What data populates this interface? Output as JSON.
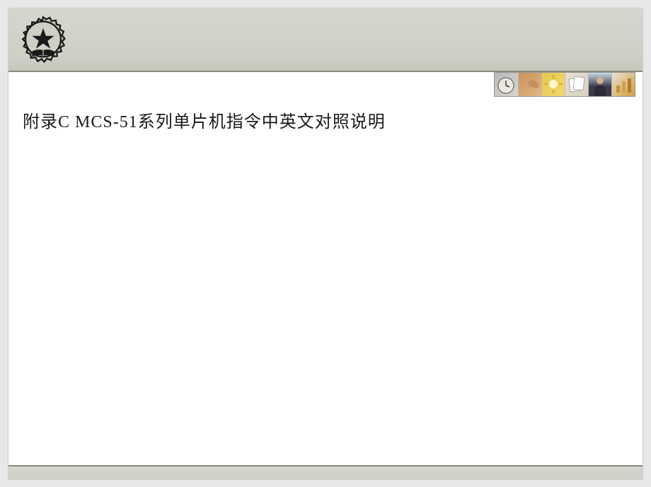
{
  "slide": {
    "title": "附录C   MCS-51系列单片机指令中英文对照说明"
  },
  "logo": {
    "name": "gear-star-book-emblem"
  },
  "thumbnails": [
    {
      "name": "clock"
    },
    {
      "name": "hands"
    },
    {
      "name": "bright"
    },
    {
      "name": "paper"
    },
    {
      "name": "person"
    },
    {
      "name": "bars"
    }
  ]
}
